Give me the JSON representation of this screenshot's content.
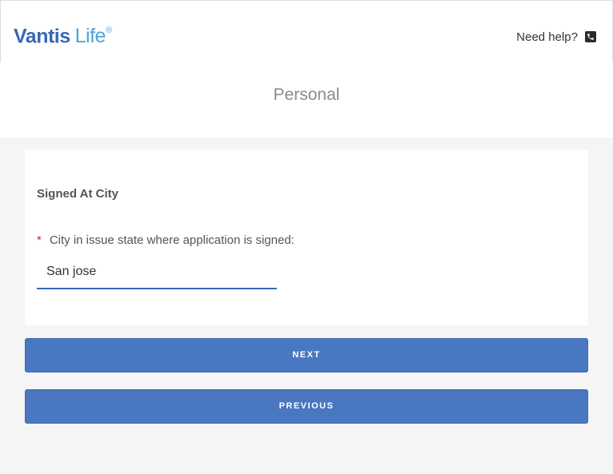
{
  "header": {
    "logo": {
      "brand": "Vantis",
      "sub": "Life",
      "registered": "®"
    },
    "help_label": "Need help?",
    "help_icon": "phone-icon"
  },
  "page": {
    "title": "Personal"
  },
  "form": {
    "section_title": "Signed At City",
    "required_marker": "*",
    "field_label": "City in issue state where application is signed:",
    "field_value": "San jose"
  },
  "buttons": {
    "next_label": "NEXT",
    "previous_label": "PREVIOUS"
  },
  "colors": {
    "brand": "#3a67b6",
    "brand_accent": "#4fa3dc",
    "button": "#4a77c2",
    "required": "#d9262b"
  }
}
